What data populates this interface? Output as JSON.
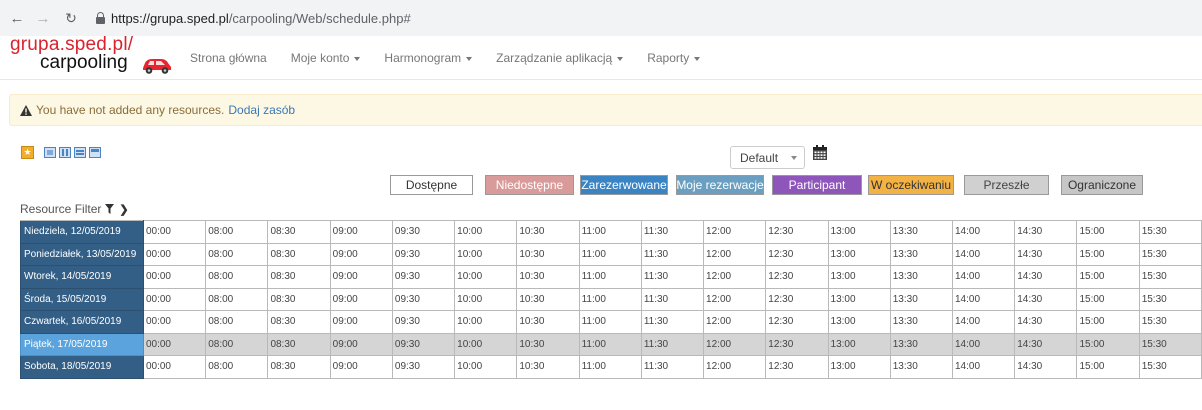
{
  "browser": {
    "url_host": "https://grupa.sped.pl",
    "url_path": "/carpooling/Web/schedule.php#"
  },
  "logo": {
    "line1": "grupa.sped.pl/",
    "line2": "carpooling"
  },
  "menu": [
    {
      "label": "Strona główna",
      "dropdown": false
    },
    {
      "label": "Moje konto",
      "dropdown": true
    },
    {
      "label": "Harmonogram",
      "dropdown": true
    },
    {
      "label": "Zarządzanie aplikacją",
      "dropdown": true
    },
    {
      "label": "Raporty",
      "dropdown": true
    }
  ],
  "alert": {
    "message": "You have not added any resources.",
    "link": "Dodaj zasób"
  },
  "schedule_select": "Default",
  "legend": [
    {
      "label": "Dostępne",
      "bg": "#ffffff",
      "fg": "#333333"
    },
    {
      "label": "Niedostępne",
      "bg": "#d99a9a",
      "fg": "#ffffff"
    },
    {
      "label": "Zarezerwowane",
      "bg": "#3a84c4",
      "fg": "#ffffff"
    },
    {
      "label": "Moje rezerwacje",
      "bg": "#6a9fc1",
      "fg": "#ffffff"
    },
    {
      "label": "Participant",
      "bg": "#8e55bb",
      "fg": "#ffffff"
    },
    {
      "label": "W oczekiwaniu",
      "bg": "#f3b244",
      "fg": "#333333"
    },
    {
      "label": "Przeszłe",
      "bg": "#d0d0d0",
      "fg": "#444444"
    },
    {
      "label": "Ograniczone",
      "bg": "#c6c6c6",
      "fg": "#333333"
    }
  ],
  "resource_filter": "Resource Filter",
  "schedule": {
    "slots": [
      "00:00",
      "08:00",
      "08:30",
      "09:00",
      "09:30",
      "10:00",
      "10:30",
      "11:00",
      "11:30",
      "12:00",
      "12:30",
      "13:00",
      "13:30",
      "14:00",
      "14:30",
      "15:00",
      "15:30"
    ],
    "days": [
      {
        "label": "Niedziela, 12/05/2019",
        "today": false
      },
      {
        "label": "Poniedziałek, 13/05/2019",
        "today": false
      },
      {
        "label": "Wtorek, 14/05/2019",
        "today": false
      },
      {
        "label": "Środa, 15/05/2019",
        "today": false
      },
      {
        "label": "Czwartek, 16/05/2019",
        "today": false
      },
      {
        "label": "Piątek, 17/05/2019",
        "today": true
      },
      {
        "label": "Sobota, 18/05/2019",
        "today": false
      }
    ]
  },
  "colors": {
    "logo_red": "#d9232d",
    "day_header": "#335f86",
    "today_header": "#5aa3dc",
    "alert_bg": "#fcf8e3"
  }
}
